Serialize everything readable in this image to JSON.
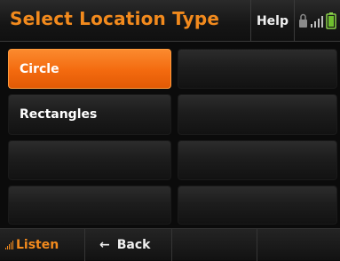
{
  "header": {
    "title": "Select Location Type",
    "help_label": "Help"
  },
  "tiles": [
    {
      "label": "Circle",
      "selected": true
    },
    {
      "label": "Rectangles",
      "selected": false
    },
    {
      "label": "",
      "selected": false
    },
    {
      "label": "",
      "selected": false
    },
    {
      "label": "",
      "selected": false
    },
    {
      "label": "",
      "selected": false
    },
    {
      "label": "",
      "selected": false
    },
    {
      "label": "",
      "selected": false
    }
  ],
  "footer": {
    "listen_label": "Listen",
    "back_arrow": "←",
    "back_label": "Back"
  },
  "status_icons": [
    "lock-icon",
    "signal-icon",
    "battery-icon"
  ],
  "colors": {
    "accent": "#f28a1d",
    "selected_tile": "#f36a0f",
    "background": "#0b0b0b"
  }
}
